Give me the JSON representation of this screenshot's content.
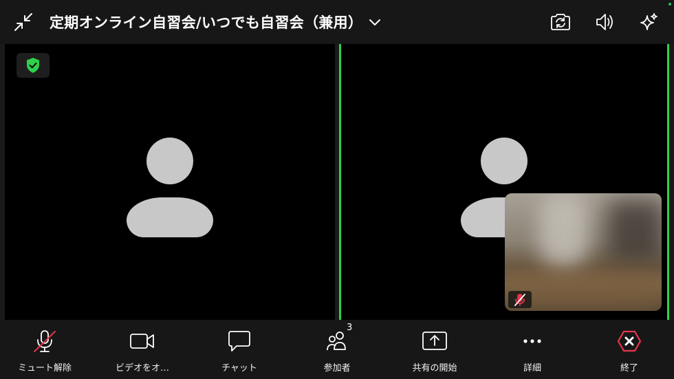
{
  "header": {
    "title": "定期オンライン自習会/いつでも自習会（兼用）",
    "icons": {
      "minimize": "compress-arrows-icon",
      "dropdown": "chevron-down-icon",
      "camera_switch": "camera-switch-icon",
      "speaker": "speaker-icon",
      "effects": "sparkle-icon"
    }
  },
  "video": {
    "encryption_badge": "shield-check-icon",
    "active_speaker_color": "#2fd14b",
    "self_view_mic": "mic-muted-icon"
  },
  "toolbar": {
    "items": [
      {
        "label": "ミュート解除",
        "icon": "mic-muted-icon"
      },
      {
        "label": "ビデオをオ…",
        "icon": "video-camera-icon"
      },
      {
        "label": "チャット",
        "icon": "chat-bubble-icon"
      },
      {
        "label": "参加者",
        "icon": "participants-icon",
        "count": "3"
      },
      {
        "label": "共有の開始",
        "icon": "share-screen-icon"
      },
      {
        "label": "詳細",
        "icon": "more-dots-icon"
      },
      {
        "label": "終了",
        "icon": "end-meeting-icon"
      }
    ]
  },
  "colors": {
    "danger": "#e8374b",
    "accent_green": "#2fd14b"
  }
}
